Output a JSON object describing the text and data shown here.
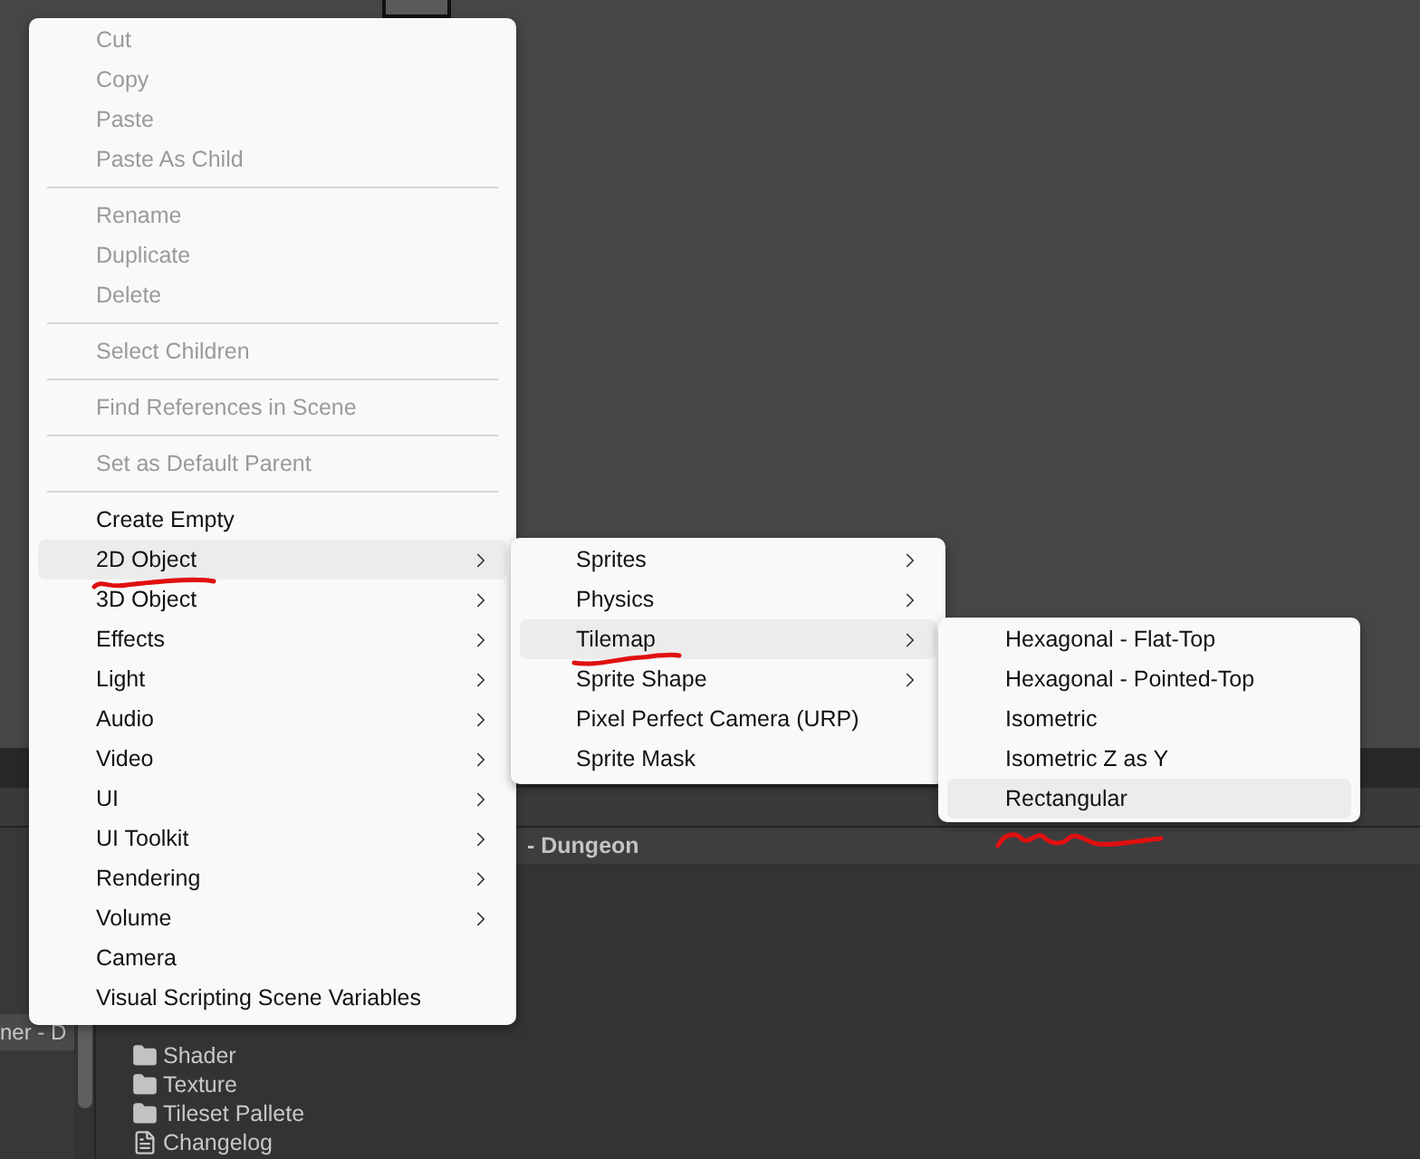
{
  "context_menu": {
    "items": [
      {
        "kind": "item",
        "label": "Cut",
        "disabled": true,
        "has_submenu": false,
        "selected": false
      },
      {
        "kind": "item",
        "label": "Copy",
        "disabled": true,
        "has_submenu": false,
        "selected": false
      },
      {
        "kind": "item",
        "label": "Paste",
        "disabled": true,
        "has_submenu": false,
        "selected": false
      },
      {
        "kind": "item",
        "label": "Paste As Child",
        "disabled": true,
        "has_submenu": false,
        "selected": false
      },
      {
        "kind": "separator"
      },
      {
        "kind": "item",
        "label": "Rename",
        "disabled": true,
        "has_submenu": false,
        "selected": false
      },
      {
        "kind": "item",
        "label": "Duplicate",
        "disabled": true,
        "has_submenu": false,
        "selected": false
      },
      {
        "kind": "item",
        "label": "Delete",
        "disabled": true,
        "has_submenu": false,
        "selected": false
      },
      {
        "kind": "separator"
      },
      {
        "kind": "item",
        "label": "Select Children",
        "disabled": true,
        "has_submenu": false,
        "selected": false
      },
      {
        "kind": "separator"
      },
      {
        "kind": "item",
        "label": "Find References in Scene",
        "disabled": true,
        "has_submenu": false,
        "selected": false
      },
      {
        "kind": "separator"
      },
      {
        "kind": "item",
        "label": "Set as Default Parent",
        "disabled": true,
        "has_submenu": false,
        "selected": false
      },
      {
        "kind": "separator"
      },
      {
        "kind": "item",
        "label": "Create Empty",
        "disabled": false,
        "has_submenu": false,
        "selected": false
      },
      {
        "kind": "item",
        "label": "2D Object",
        "disabled": false,
        "has_submenu": true,
        "selected": true
      },
      {
        "kind": "item",
        "label": "3D Object",
        "disabled": false,
        "has_submenu": true,
        "selected": false
      },
      {
        "kind": "item",
        "label": "Effects",
        "disabled": false,
        "has_submenu": true,
        "selected": false
      },
      {
        "kind": "item",
        "label": "Light",
        "disabled": false,
        "has_submenu": true,
        "selected": false
      },
      {
        "kind": "item",
        "label": "Audio",
        "disabled": false,
        "has_submenu": true,
        "selected": false
      },
      {
        "kind": "item",
        "label": "Video",
        "disabled": false,
        "has_submenu": true,
        "selected": false
      },
      {
        "kind": "item",
        "label": "UI",
        "disabled": false,
        "has_submenu": true,
        "selected": false
      },
      {
        "kind": "item",
        "label": "UI Toolkit",
        "disabled": false,
        "has_submenu": true,
        "selected": false
      },
      {
        "kind": "item",
        "label": "Rendering",
        "disabled": false,
        "has_submenu": true,
        "selected": false
      },
      {
        "kind": "item",
        "label": "Volume",
        "disabled": false,
        "has_submenu": true,
        "selected": false
      },
      {
        "kind": "item",
        "label": "Camera",
        "disabled": false,
        "has_submenu": false,
        "selected": false
      },
      {
        "kind": "item",
        "label": "Visual Scripting Scene Variables",
        "disabled": false,
        "has_submenu": false,
        "selected": false
      }
    ]
  },
  "submenu": {
    "items": [
      {
        "kind": "item",
        "label": "Sprites",
        "disabled": false,
        "has_submenu": true,
        "selected": false
      },
      {
        "kind": "item",
        "label": "Physics",
        "disabled": false,
        "has_submenu": true,
        "selected": false
      },
      {
        "kind": "item",
        "label": "Tilemap",
        "disabled": false,
        "has_submenu": true,
        "selected": true
      },
      {
        "kind": "item",
        "label": "Sprite Shape",
        "disabled": false,
        "has_submenu": true,
        "selected": false
      },
      {
        "kind": "item",
        "label": "Pixel Perfect Camera (URP)",
        "disabled": false,
        "has_submenu": false,
        "selected": false
      },
      {
        "kind": "item",
        "label": "Sprite Mask",
        "disabled": false,
        "has_submenu": false,
        "selected": false
      }
    ]
  },
  "nested_submenu": {
    "items": [
      {
        "kind": "item",
        "label": "Hexagonal - Flat-Top",
        "disabled": false,
        "has_submenu": false,
        "selected": false
      },
      {
        "kind": "item",
        "label": "Hexagonal - Pointed-Top",
        "disabled": false,
        "has_submenu": false,
        "selected": false
      },
      {
        "kind": "item",
        "label": "Isometric",
        "disabled": false,
        "has_submenu": false,
        "selected": false
      },
      {
        "kind": "item",
        "label": "Isometric Z as Y",
        "disabled": false,
        "has_submenu": false,
        "selected": false
      },
      {
        "kind": "item",
        "label": "Rectangular",
        "disabled": false,
        "has_submenu": false,
        "selected": true
      }
    ]
  },
  "hierarchy_panel": {
    "label": "ner - D"
  },
  "scene_header": {
    "title": "- Dungeon"
  },
  "project_files": [
    {
      "kind": "folder",
      "name": "Shader"
    },
    {
      "kind": "folder",
      "name": "Texture"
    },
    {
      "kind": "folder",
      "name": "Tileset Pallete"
    },
    {
      "kind": "file",
      "name": "Changelog"
    }
  ]
}
